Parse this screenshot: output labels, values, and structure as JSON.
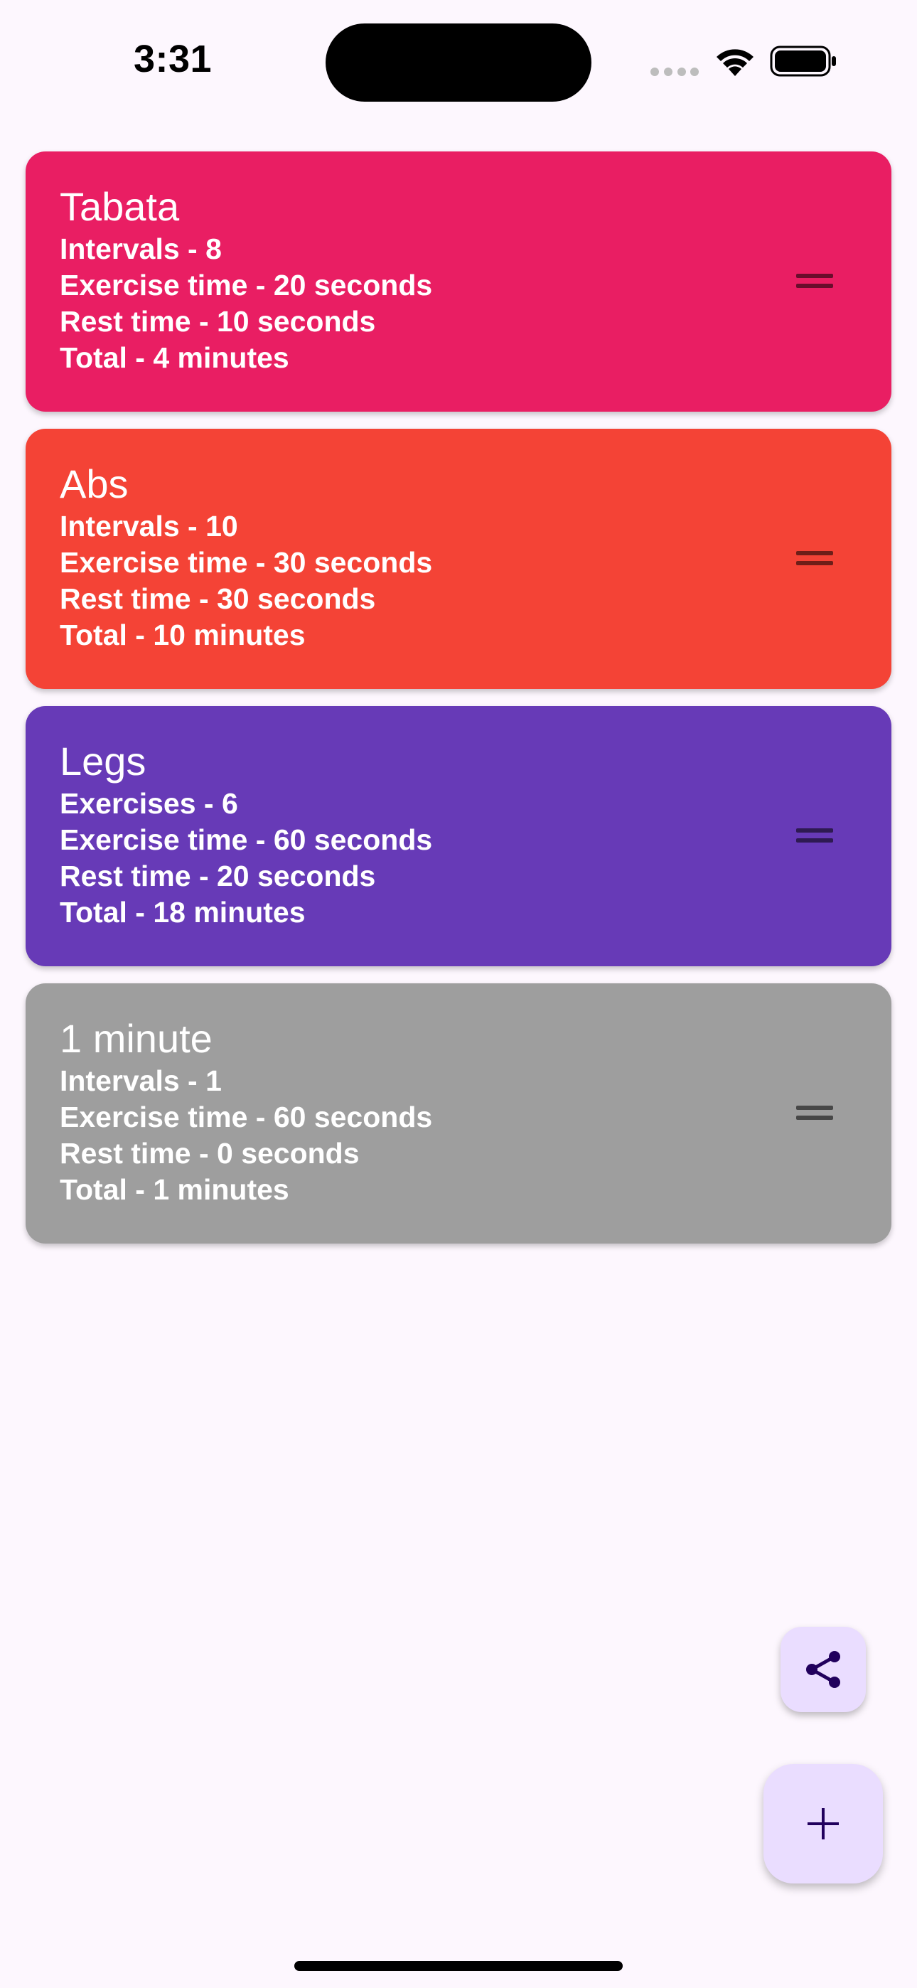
{
  "status_bar": {
    "time": "3:31"
  },
  "workouts": [
    {
      "title": "Tabata",
      "lines": [
        "Intervals - 8",
        "Exercise time - 20 seconds",
        "Rest time - 10 seconds",
        "Total - 4 minutes"
      ],
      "color": "#e91e63"
    },
    {
      "title": "Abs",
      "lines": [
        "Intervals - 10",
        "Exercise time - 30 seconds",
        "Rest time - 30 seconds",
        "Total - 10 minutes"
      ],
      "color": "#f44336"
    },
    {
      "title": "Legs",
      "lines": [
        "Exercises - 6",
        "Exercise time - 60 seconds",
        "Rest time - 20 seconds",
        "Total - 18 minutes"
      ],
      "color": "#673ab7"
    },
    {
      "title": "1 minute",
      "lines": [
        "Intervals - 1",
        "Exercise time - 60 seconds",
        "Rest time - 0 seconds",
        "Total - 1 minutes"
      ],
      "color": "#9e9e9e"
    }
  ],
  "fabs": {
    "share_icon": "share-icon",
    "add_icon": "plus-icon",
    "color": "#eaddff",
    "icon_color": "#21005d"
  }
}
